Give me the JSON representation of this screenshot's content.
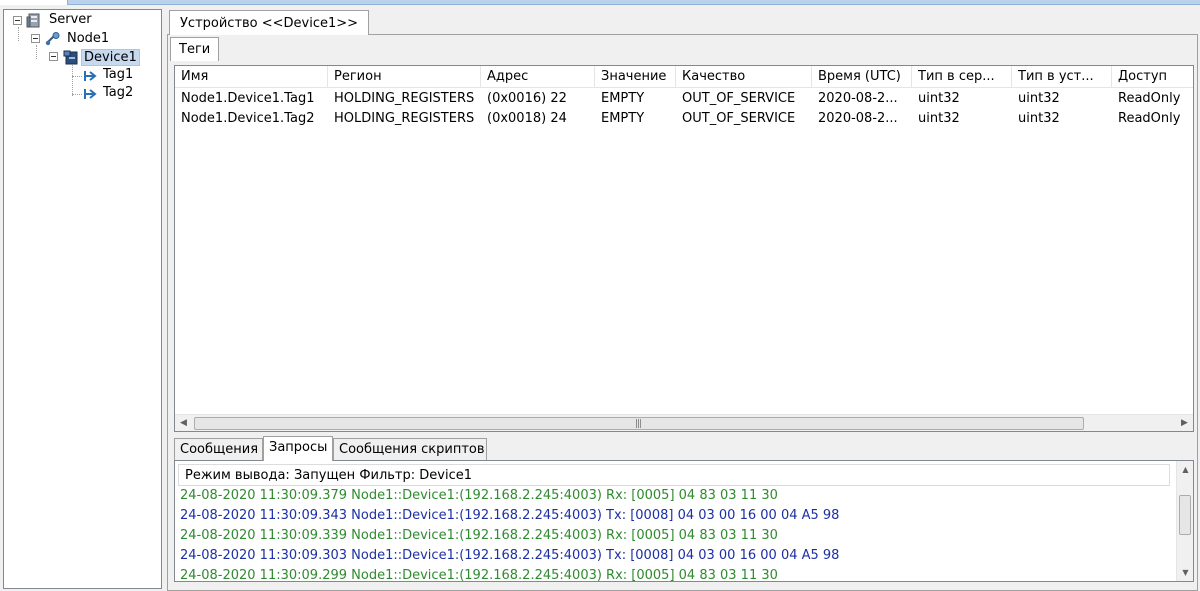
{
  "tree": {
    "server": "Server",
    "node": "Node1",
    "device": "Device1",
    "tags": [
      "Tag1",
      "Tag2"
    ]
  },
  "document_tab": "Устройство <<Device1>>",
  "inner_tab": "Теги",
  "table": {
    "columns": [
      "Имя",
      "Регион",
      "Адрес",
      "Значение",
      "Качество",
      "Время (UTC)",
      "Тип в сер...",
      "Тип в уст...",
      "Доступ"
    ],
    "rows": [
      [
        "Node1.Device1.Tag1",
        "HOLDING_REGISTERS",
        "(0x0016) 22",
        "EMPTY",
        "OUT_OF_SERVICE",
        "2020-08-2...",
        "uint32",
        "uint32",
        "ReadOnly"
      ],
      [
        "Node1.Device1.Tag2",
        "HOLDING_REGISTERS",
        "(0x0018) 24",
        "EMPTY",
        "OUT_OF_SERVICE",
        "2020-08-2...",
        "uint32",
        "uint32",
        "ReadOnly"
      ]
    ]
  },
  "bottom_tabs": [
    "Сообщения",
    "Запросы",
    "Сообщения скриптов"
  ],
  "log": {
    "status": "Режим вывода: Запущен Фильтр: Device1",
    "lines": [
      {
        "text": "24-08-2020 11:30:09.379 Node1::Device1:(192.168.2.245:4003) Rx: [0005] 04 83 03 11 30",
        "kind": "rx"
      },
      {
        "text": "24-08-2020 11:30:09.343 Node1::Device1:(192.168.2.245:4003) Tx: [0008] 04 03 00 16 00 04 A5 98",
        "kind": "tx"
      },
      {
        "text": "24-08-2020 11:30:09.339 Node1::Device1:(192.168.2.245:4003) Rx: [0005] 04 83 03 11 30",
        "kind": "rx"
      },
      {
        "text": "24-08-2020 11:30:09.303 Node1::Device1:(192.168.2.245:4003) Tx: [0008] 04 03 00 16 00 04 A5 98",
        "kind": "tx"
      },
      {
        "text": "24-08-2020 11:30:09.299 Node1::Device1:(192.168.2.245:4003) Rx: [0005] 04 83 03 11 30",
        "kind": "rx"
      }
    ]
  },
  "colors": {
    "rx": "#2e8b2e",
    "tx": "#1d2fa5",
    "selection": "#c6d9ef"
  },
  "icons": {
    "server": "server-icon",
    "node": "node-icon",
    "device": "device-icon",
    "tag": "tag-arrow-icon"
  }
}
